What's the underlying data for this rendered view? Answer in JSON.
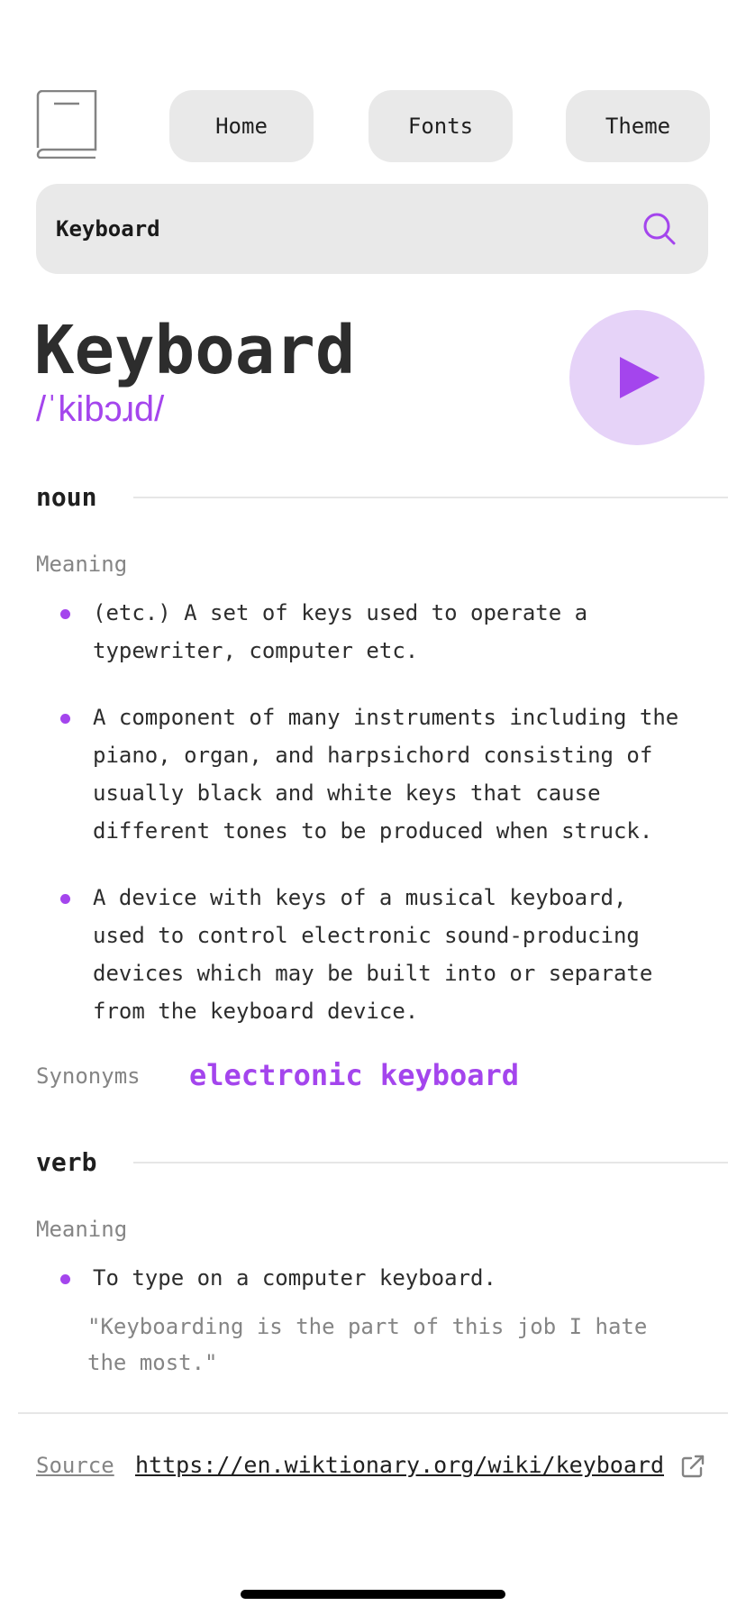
{
  "nav": {
    "home_label": "Home",
    "fonts_label": "Fonts",
    "theme_label": "Theme"
  },
  "search": {
    "value": "Keyboard",
    "icon": "search-icon"
  },
  "entry": {
    "word": "Keyboard",
    "phonetic": "/ˈkibɔɹd/",
    "play_icon": "play-icon"
  },
  "noun": {
    "pos": "noun",
    "meaning_label": "Meaning",
    "definitions": [
      "(etc.) A set of keys used to operate a typewriter, computer etc.",
      "A component of many instruments including the piano, organ, and harpsichord consisting of usually black and white keys that cause different tones to be produced when struck.",
      "A device with keys of a musical keyboard, used to control electronic sound-producing devices which may be built into or separate from the keyboard device."
    ],
    "synonyms_label": "Synonyms",
    "synonyms": [
      "electronic keyboard"
    ]
  },
  "verb": {
    "pos": "verb",
    "meaning_label": "Meaning",
    "definitions": [
      "To type on a computer keyboard."
    ],
    "example": "\"Keyboarding is the part of this job I hate the most.\""
  },
  "footer": {
    "source_label": "Source",
    "source_url": "https://en.wiktionary.org/wiki/keyboard",
    "external_icon": "external-link-icon"
  },
  "colors": {
    "accent": "#a445ed",
    "accent_soft": "#e6d3f8",
    "surface": "#e9e9e9",
    "text": "#2d2d2d",
    "muted": "#858585"
  }
}
